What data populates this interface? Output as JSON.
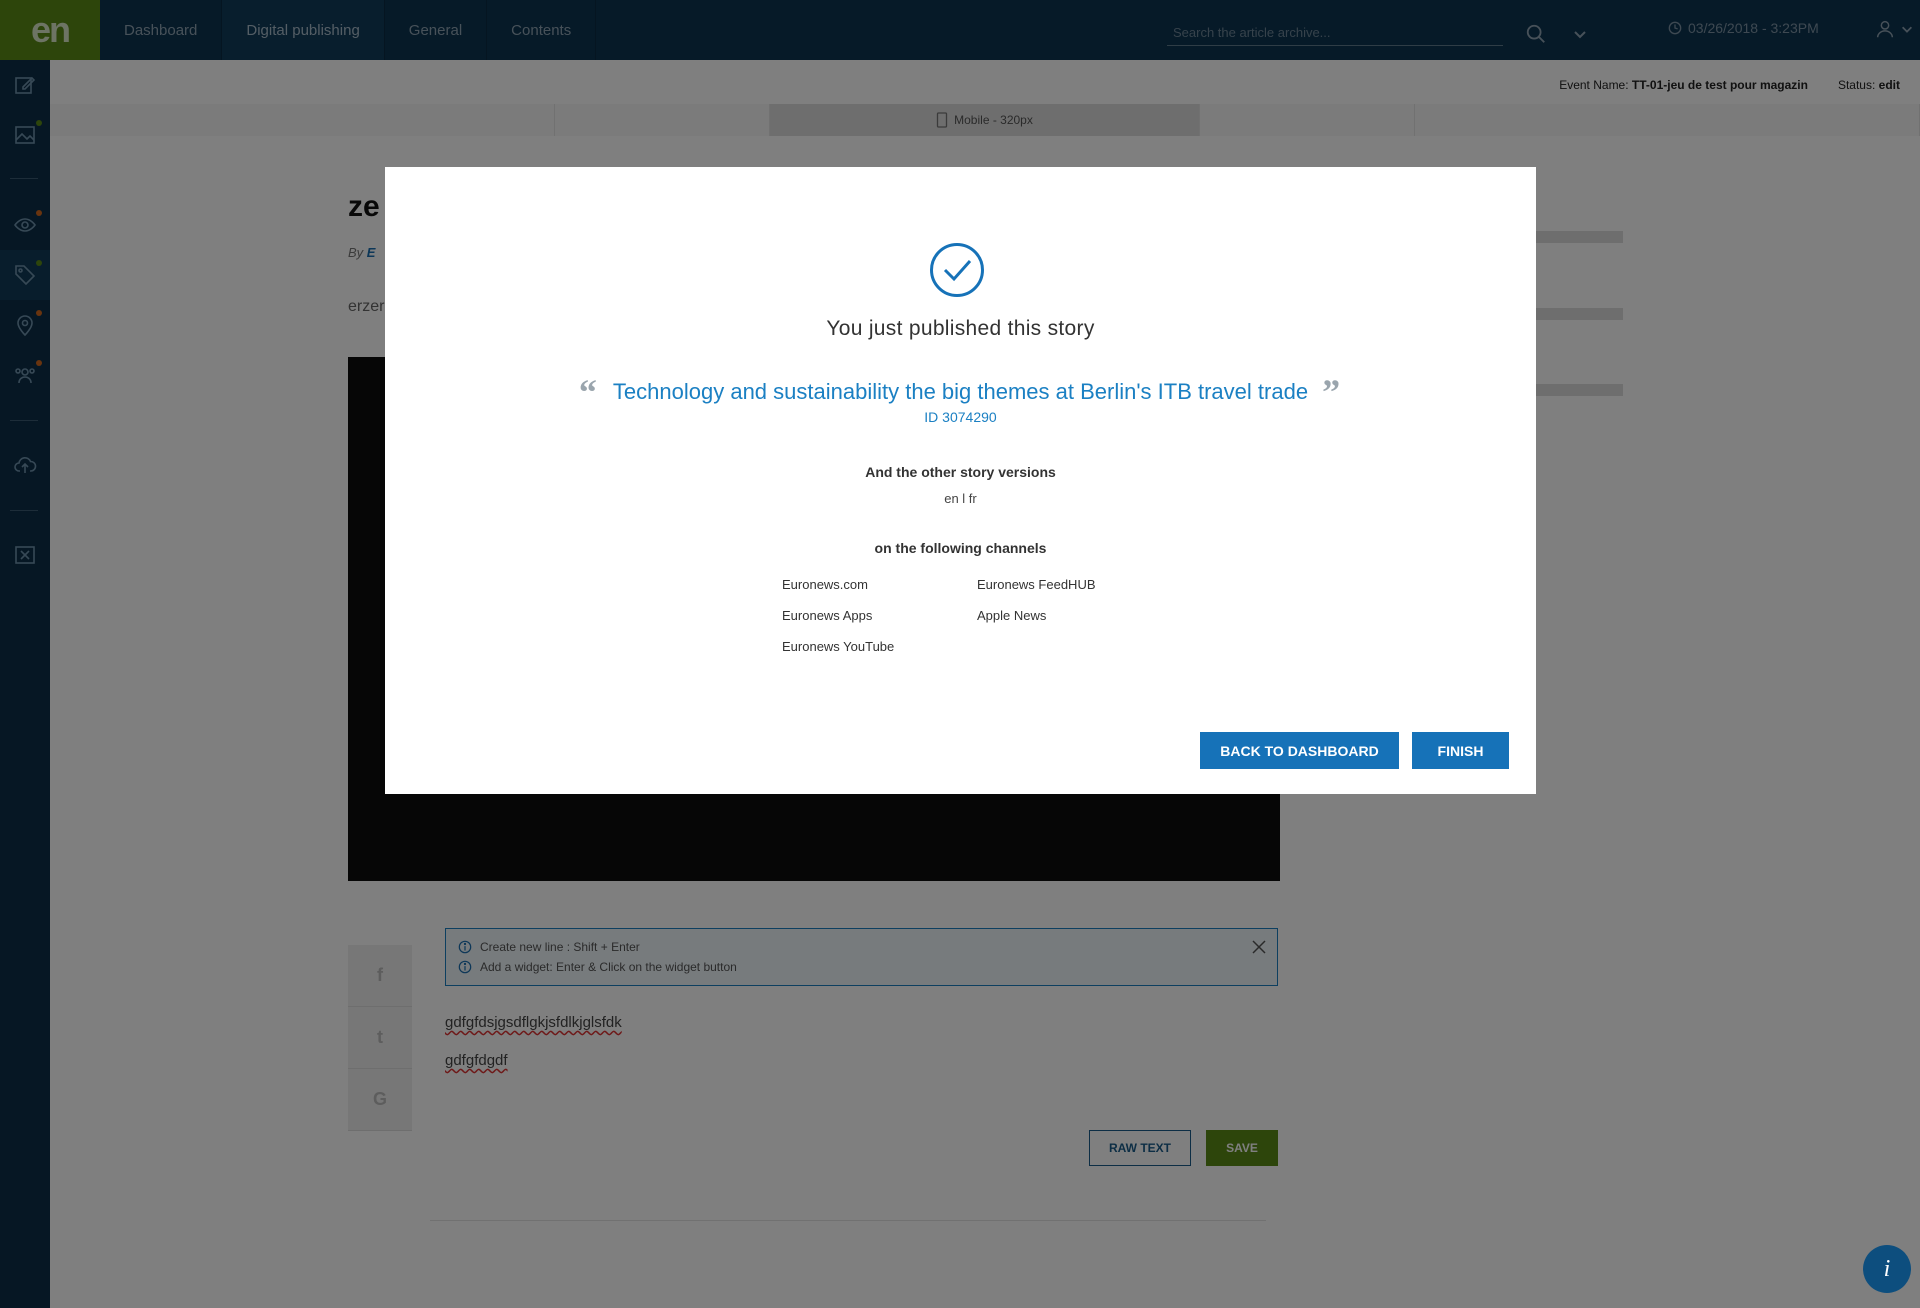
{
  "app": {
    "logo": "en",
    "nav": [
      "Dashboard",
      "Digital publishing",
      "General",
      "Contents"
    ],
    "active_nav": "Digital publishing",
    "search_placeholder": "Search the article archive...",
    "datetime": "03/26/2018 - 3:23PM"
  },
  "event": {
    "name_label": "Event Name:",
    "name": "TT-01-jeu de test pour magazin",
    "status_label": "Status:",
    "status": "edit"
  },
  "device": {
    "active": "Mobile - 320px"
  },
  "article": {
    "title_partial": "ze",
    "by_label": "By",
    "author_partial": "E",
    "lead_partial": "erzer",
    "hints": [
      "Create new line : Shift + Enter",
      "Add a widget: Enter & Click on the widget button"
    ],
    "body_lines": [
      "gdfgfdsjgsdflgkjsfdlkjglsfdk",
      "gdfgfdgdf"
    ],
    "social": [
      "f",
      "t",
      "G"
    ],
    "raw_text_label": "RAW TEXT",
    "save_label": "SAVE"
  },
  "modal": {
    "heading": "You just published this story",
    "story_title": "Technology and sustainability the big themes at Berlin's ITB travel trade",
    "story_id": "ID 3074290",
    "versions_label": "And the other story versions",
    "versions": "en l fr",
    "channels_label": "on the following channels",
    "channels": [
      "Euronews.com",
      "Euronews FeedHUB",
      "Euronews Apps",
      "Apple News",
      "Euronews YouTube"
    ],
    "back_label": "BACK TO DASHBOARD",
    "finish_label": "FINISH"
  },
  "colors": {
    "brand_green": "#5b8a17",
    "navy": "#0d3551",
    "accent_blue": "#1672b8",
    "link_blue": "#1b80c3"
  }
}
